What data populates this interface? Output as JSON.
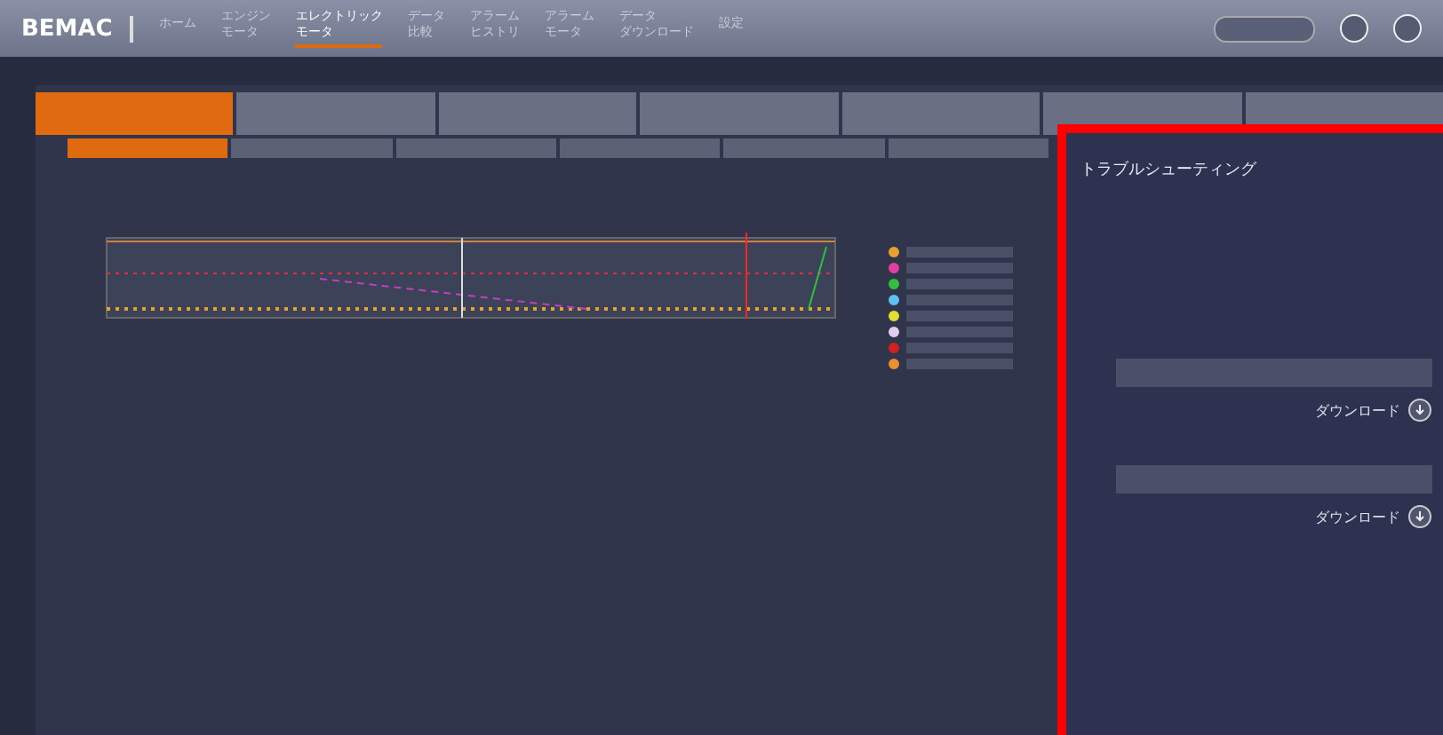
{
  "header": {
    "logo": "BEMAC",
    "nav": [
      {
        "lines": [
          "ホーム"
        ],
        "selected": false
      },
      {
        "lines": [
          "エンジン",
          "モータ"
        ],
        "selected": false
      },
      {
        "lines": [
          "エレクトリック",
          "モータ"
        ],
        "selected": true
      },
      {
        "lines": [
          "データ",
          "比較"
        ],
        "selected": false
      },
      {
        "lines": [
          "アラーム",
          "ヒストリ"
        ],
        "selected": false
      },
      {
        "lines": [
          "アラーム",
          "モータ"
        ],
        "selected": false
      },
      {
        "lines": [
          "データ",
          "ダウンロード"
        ],
        "selected": false
      },
      {
        "lines": [
          "設定"
        ],
        "selected": false
      }
    ]
  },
  "tabs": [
    {
      "selected": true
    },
    {
      "selected": false
    },
    {
      "selected": false
    },
    {
      "selected": false
    },
    {
      "selected": false
    },
    {
      "selected": false
    },
    {
      "selected": false
    }
  ],
  "subtabs": [
    {
      "selected": true
    },
    {
      "selected": false
    },
    {
      "selected": false
    },
    {
      "selected": false
    },
    {
      "selected": false
    },
    {
      "selected": false
    }
  ],
  "legend": [
    {
      "color": "#e8a030"
    },
    {
      "color": "#e040a0"
    },
    {
      "color": "#30c040"
    },
    {
      "color": "#60c0f0"
    },
    {
      "color": "#e0e030"
    },
    {
      "color": "#e0d0f0"
    },
    {
      "color": "#d02020"
    },
    {
      "color": "#e89030"
    }
  ],
  "panel": {
    "title": "トラブルシューティング",
    "actions": [
      {
        "label": "ダウンロード"
      },
      {
        "label": "ダウンロード"
      }
    ]
  }
}
